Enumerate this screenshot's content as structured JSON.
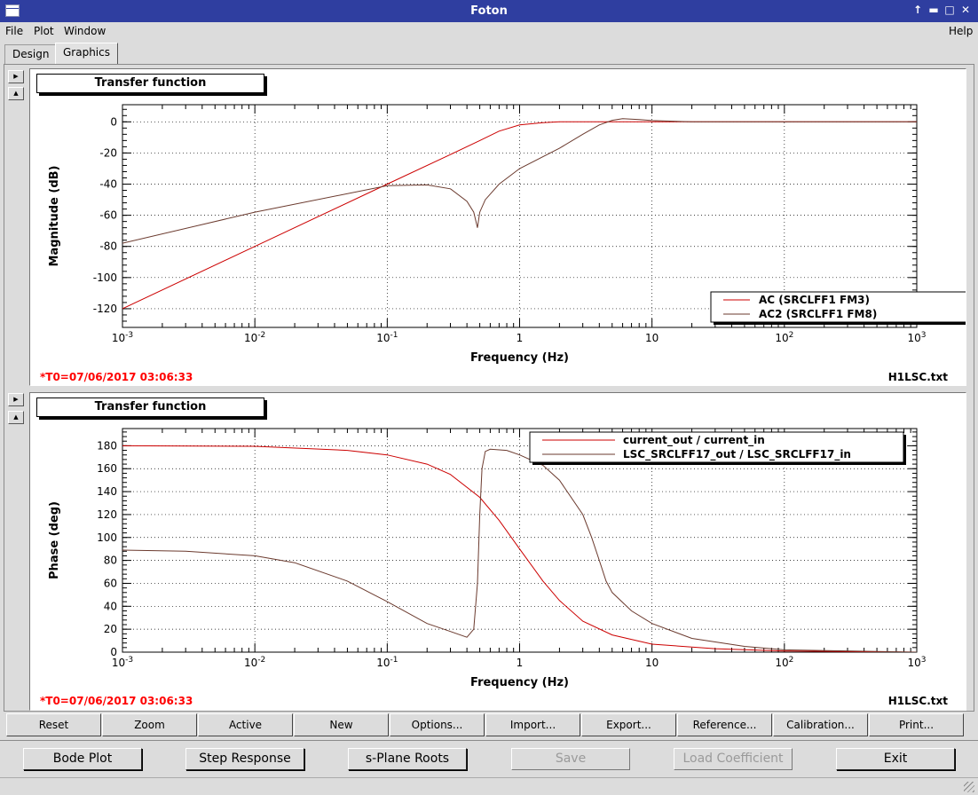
{
  "window": {
    "title": "Foton"
  },
  "menu": {
    "file": "File",
    "plot": "Plot",
    "window": "Window",
    "help": "Help"
  },
  "tabs": [
    {
      "label": "Design"
    },
    {
      "label": "Graphics"
    }
  ],
  "plots": [
    {
      "pad_title": "Transfer function",
      "timestamp": "*T0=07/06/2017 03:06:33",
      "filename": "H1LSC.txt"
    },
    {
      "pad_title": "Transfer function",
      "timestamp": "*T0=07/06/2017 03:06:33",
      "filename": "H1LSC.txt"
    }
  ],
  "toolbar": [
    "Reset",
    "Zoom",
    "Active",
    "New",
    "Options...",
    "Import...",
    "Export...",
    "Reference...",
    "Calibration...",
    "Print..."
  ],
  "bottom_buttons": [
    {
      "label": "Bode Plot",
      "enabled": true
    },
    {
      "label": "Step Response",
      "enabled": true
    },
    {
      "label": "s-Plane Roots",
      "enabled": true
    },
    {
      "label": "Save",
      "enabled": false
    },
    {
      "label": "Load Coefficient",
      "enabled": false
    },
    {
      "label": "Exit",
      "enabled": true
    }
  ],
  "colors": {
    "series1": "#cc0000",
    "series2": "#6b3a2e",
    "title_bar": "#2f3ea0",
    "timestamp": "#ff0000"
  },
  "chart_data": [
    {
      "type": "line",
      "xlabel": "Frequency (Hz)",
      "ylabel": "Magnitude (dB)",
      "xscale": "log",
      "xlim": [
        0.001,
        1000
      ],
      "ylim": [
        -132,
        11
      ],
      "x_ticks": [
        {
          "value": 0.001,
          "base": "10",
          "exp": "-3"
        },
        {
          "value": 0.01,
          "base": "10",
          "exp": "-2"
        },
        {
          "value": 0.1,
          "base": "10",
          "exp": "-1"
        },
        {
          "value": 1,
          "base": "1",
          "exp": ""
        },
        {
          "value": 10,
          "base": "10",
          "exp": ""
        },
        {
          "value": 100,
          "base": "10",
          "exp": "2"
        },
        {
          "value": 1000,
          "base": "10",
          "exp": "3"
        }
      ],
      "y_ticks": [
        0,
        -20,
        -40,
        -60,
        -80,
        -100,
        -120
      ],
      "grid": true,
      "legend_position": "bottom-right",
      "series": [
        {
          "name": "AC (SRCLFF1 FM3)",
          "x": [
            0.001,
            0.01,
            0.1,
            0.3,
            0.5,
            0.7,
            1,
            1.5,
            2,
            3,
            10,
            100,
            1000
          ],
          "y": [
            -120,
            -80,
            -40,
            -21,
            -12,
            -6,
            -2,
            -0.5,
            0,
            0,
            0,
            0,
            0
          ]
        },
        {
          "name": "AC2 (SRCLFF1 FM8)",
          "x": [
            0.001,
            0.01,
            0.1,
            0.2,
            0.3,
            0.4,
            0.45,
            0.48,
            0.5,
            0.55,
            0.7,
            1,
            2,
            3,
            4,
            5,
            6,
            8,
            10,
            20,
            100,
            1000
          ],
          "y": [
            -78,
            -58,
            -41,
            -40.5,
            -43,
            -51,
            -58,
            -68,
            -58,
            -50,
            -40,
            -30,
            -17,
            -8,
            -2,
            1,
            2,
            1.5,
            0.8,
            0,
            0,
            0
          ]
        }
      ]
    },
    {
      "type": "line",
      "xlabel": "Frequency (Hz)",
      "ylabel": "Phase (deg)",
      "xscale": "log",
      "xlim": [
        0.001,
        1000
      ],
      "ylim": [
        0,
        195
      ],
      "x_ticks": [
        {
          "value": 0.001,
          "base": "10",
          "exp": "-3"
        },
        {
          "value": 0.01,
          "base": "10",
          "exp": "-2"
        },
        {
          "value": 0.1,
          "base": "10",
          "exp": "-1"
        },
        {
          "value": 1,
          "base": "1",
          "exp": ""
        },
        {
          "value": 10,
          "base": "10",
          "exp": ""
        },
        {
          "value": 100,
          "base": "10",
          "exp": "2"
        },
        {
          "value": 1000,
          "base": "10",
          "exp": "3"
        }
      ],
      "y_ticks": [
        0,
        20,
        40,
        60,
        80,
        100,
        120,
        140,
        160,
        180
      ],
      "grid": true,
      "legend_position": "top-right",
      "series": [
        {
          "name": "current_out / current_in",
          "x": [
            0.001,
            0.01,
            0.05,
            0.1,
            0.2,
            0.3,
            0.5,
            0.7,
            1,
            1.5,
            2,
            3,
            5,
            10,
            30,
            100,
            1000
          ],
          "y": [
            180,
            179.5,
            176,
            172,
            164,
            155,
            135,
            115,
            90,
            62,
            45,
            27,
            15,
            7,
            3,
            1,
            0
          ]
        },
        {
          "name": "LSC_SRCLFF17_out / LSC_SRCLFF17_in",
          "x": [
            0.001,
            0.003,
            0.01,
            0.02,
            0.05,
            0.1,
            0.2,
            0.3,
            0.4,
            0.45,
            0.48,
            0.5,
            0.52,
            0.55,
            0.6,
            0.8,
            1,
            1.5,
            2,
            3,
            3.5,
            4,
            4.5,
            5,
            7,
            10,
            20,
            50,
            100,
            1000
          ],
          "y": [
            89,
            88,
            84,
            78,
            62,
            44,
            25,
            18,
            13,
            20,
            60,
            120,
            160,
            175,
            177,
            176,
            172,
            163,
            150,
            120,
            100,
            80,
            62,
            52,
            36,
            25,
            12,
            5,
            2,
            0
          ]
        }
      ]
    }
  ]
}
